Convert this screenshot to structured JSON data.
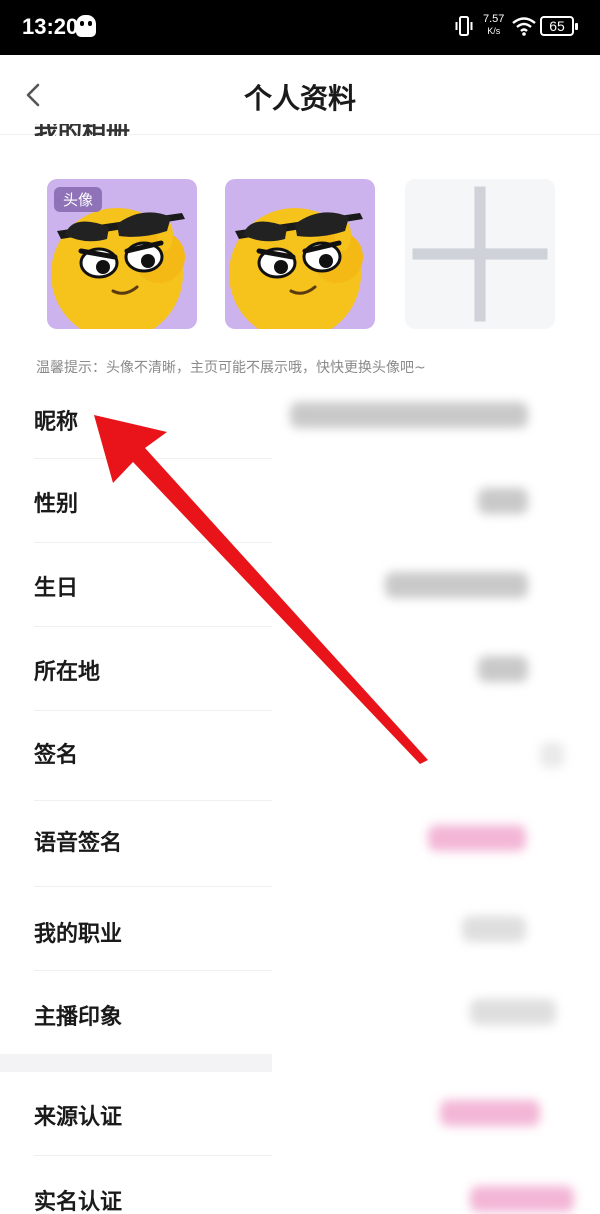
{
  "status_bar": {
    "time": "13:20",
    "net_speed": "7.57",
    "net_unit": "K/s",
    "battery": "65"
  },
  "header": {
    "title": "个人资料"
  },
  "photos_section": {
    "title": "我的相册",
    "avatar_tag": "头像",
    "tip": "温馨提示：头像不清晰，主页可能不展示哦，快快更换头像吧~"
  },
  "fields": [
    {
      "label": "昵称"
    },
    {
      "label": "性别"
    },
    {
      "label": "生日"
    },
    {
      "label": "所在地"
    },
    {
      "label": "签名"
    },
    {
      "label": "语音签名"
    },
    {
      "label": "我的职业"
    },
    {
      "label": "主播印象"
    },
    {
      "label": "来源认证"
    },
    {
      "label": "实名认证"
    }
  ],
  "colors": {
    "photo_bg": "#cdb3ee",
    "avatar_tag_bg": "#8f72b8",
    "annotation_arrow": "#e8141a"
  }
}
